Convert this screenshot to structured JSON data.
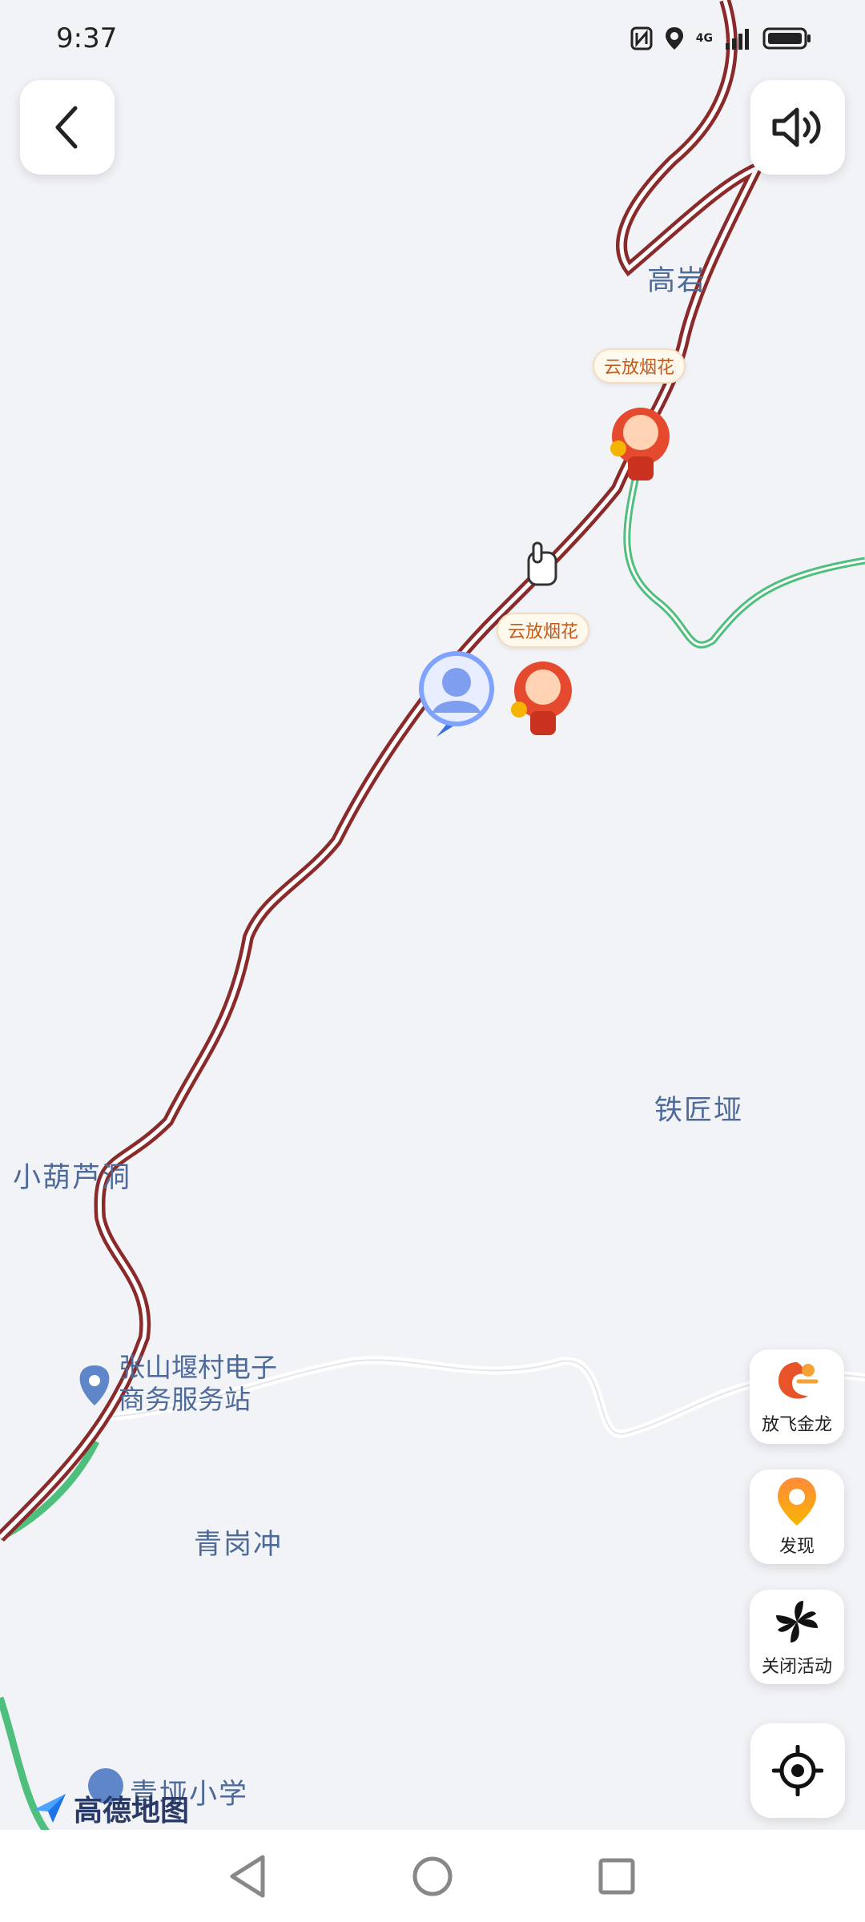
{
  "status_bar": {
    "time": "9:37",
    "network": "4G",
    "icons": [
      "nfc-icon",
      "location-icon",
      "signal-icon",
      "battery-icon"
    ]
  },
  "top_controls": {
    "back_icon": "chevron-left-icon",
    "sound_icon": "speaker-icon"
  },
  "map": {
    "place_labels": [
      "高岩",
      "铁匠垭",
      "小葫芦洞",
      "青岗冲"
    ],
    "poi": {
      "name_line1": "张山堰村电子",
      "name_line2": "商务服务站"
    },
    "school_label": "青垭小学",
    "event_bubbles": [
      "云放烟花",
      "云放烟花"
    ],
    "colors": {
      "main_road": "#8a2a2a",
      "green_road": "#4fbf7d",
      "minor_road": "#ffffff",
      "background": "#f2f3f7"
    }
  },
  "side_buttons": [
    {
      "icon": "golden-dragon-icon",
      "label": "放飞金龙"
    },
    {
      "icon": "discover-pin-icon",
      "label": "发现"
    },
    {
      "icon": "pinwheel-icon",
      "label": "关闭活动"
    }
  ],
  "locate_icon": "locate-target-icon",
  "logo_text": "高德地图",
  "nav_bar": {
    "icons": [
      "back-triangle-icon",
      "home-circle-icon",
      "recents-square-icon"
    ]
  }
}
